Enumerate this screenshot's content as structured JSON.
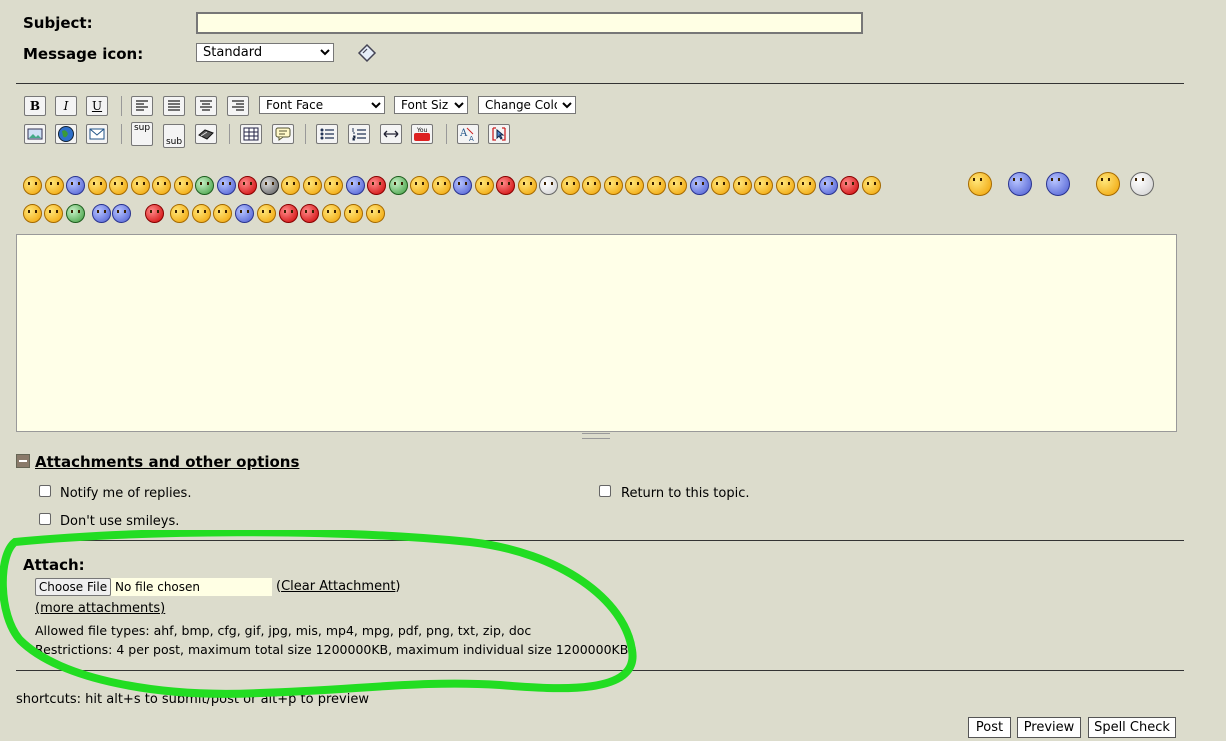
{
  "form": {
    "subject_label": "Subject:",
    "subject_value": "",
    "message_icon_label": "Message icon:",
    "message_icon_selected": "Standard"
  },
  "toolbar": {
    "font_face": "Font Face",
    "font_size": "Font Size",
    "change_color": "Change Color",
    "bold": "B",
    "italic": "I",
    "underline": "U",
    "sup": "sup",
    "sub": "sub"
  },
  "options": {
    "section_title": "Attachments and other options",
    "notify": "Notify me of replies.",
    "return_topic": "Return to this topic.",
    "no_smileys": "Don't use smileys."
  },
  "attach": {
    "label": "Attach:",
    "choose_file": "Choose File",
    "no_file": "No file chosen",
    "clear_open": "(",
    "clear_link": "Clear Attachment",
    "clear_close": ")",
    "more": "(more attachments)",
    "allowed": "Allowed file types: ahf, bmp, cfg, gif, jpg, mis, mp4, mpg, pdf, png, txt, zip, doc",
    "restrictions": "Restrictions: 4 per post, maximum total size 1200000KB, maximum individual size 1200000KB"
  },
  "footer": {
    "shortcuts": "shortcuts: hit alt+s to submit/post or alt+p to preview",
    "post": "Post",
    "preview": "Preview",
    "spell_check": "Spell Check"
  },
  "highlight_color": "#22dd22"
}
